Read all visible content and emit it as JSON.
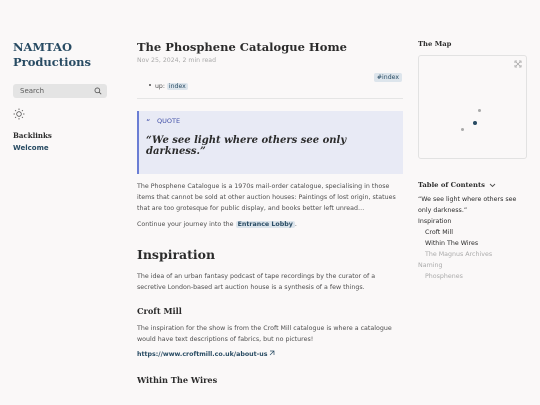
{
  "site": {
    "name": "NAMTAO Productions"
  },
  "search": {
    "placeholder": "Search"
  },
  "backlinks": {
    "heading": "Backlinks",
    "items": [
      "Welcome"
    ]
  },
  "page": {
    "title": "The Phosphene Catalogue Home",
    "meta": "Nov 25, 2024, 2 min read",
    "tag": "#index",
    "up_label": "up:",
    "up_link": "index",
    "quote_label": "QUOTE",
    "quote_text": "“We see light where others see only darkness.”",
    "intro": "The Phosphene Catalogue is a 1970s mail-order catalogue, specialising in those items that cannot be sold at other auction houses: Paintings of lost origin, statues that are too grotesque for public display, and books better left unread…",
    "continue_prefix": "Continue your journey into the",
    "continue_link": "Entrance Lobby",
    "continue_suffix": ".",
    "inspiration_heading": "Inspiration",
    "inspiration_text": "The idea of an urban fantasy podcast of tape recordings by the curator of a secretive London-based art auction house is a synthesis of a few things.",
    "croft_heading": "Croft Mill",
    "croft_text": "The inspiration for the show is from the Croft Mill catalogue is where a catalogue would have text descriptions of fabrics, but no pictures!",
    "croft_url": "https://www.croftmill.co.uk/about-us",
    "wires_heading": "Within The Wires"
  },
  "map": {
    "heading": "The Map"
  },
  "toc": {
    "heading": "Table of Contents",
    "items": [
      {
        "text": "“We see light where others see only darkness.”",
        "level": 1,
        "muted": false
      },
      {
        "text": "Inspiration",
        "level": 1,
        "muted": false
      },
      {
        "text": "Croft Mill",
        "level": 2,
        "muted": false
      },
      {
        "text": "Within The Wires",
        "level": 2,
        "muted": false
      },
      {
        "text": "The Magnus Archives",
        "level": 2,
        "muted": true
      },
      {
        "text": "Naming",
        "level": 1,
        "muted": true
      },
      {
        "text": "Phosphenes",
        "level": 2,
        "muted": true
      }
    ]
  },
  "colors": {
    "accent": "#284b63",
    "quote_border": "#6b7ed4",
    "quote_bg": "#e8eaf5",
    "tag_bg": "#dde5ec"
  }
}
